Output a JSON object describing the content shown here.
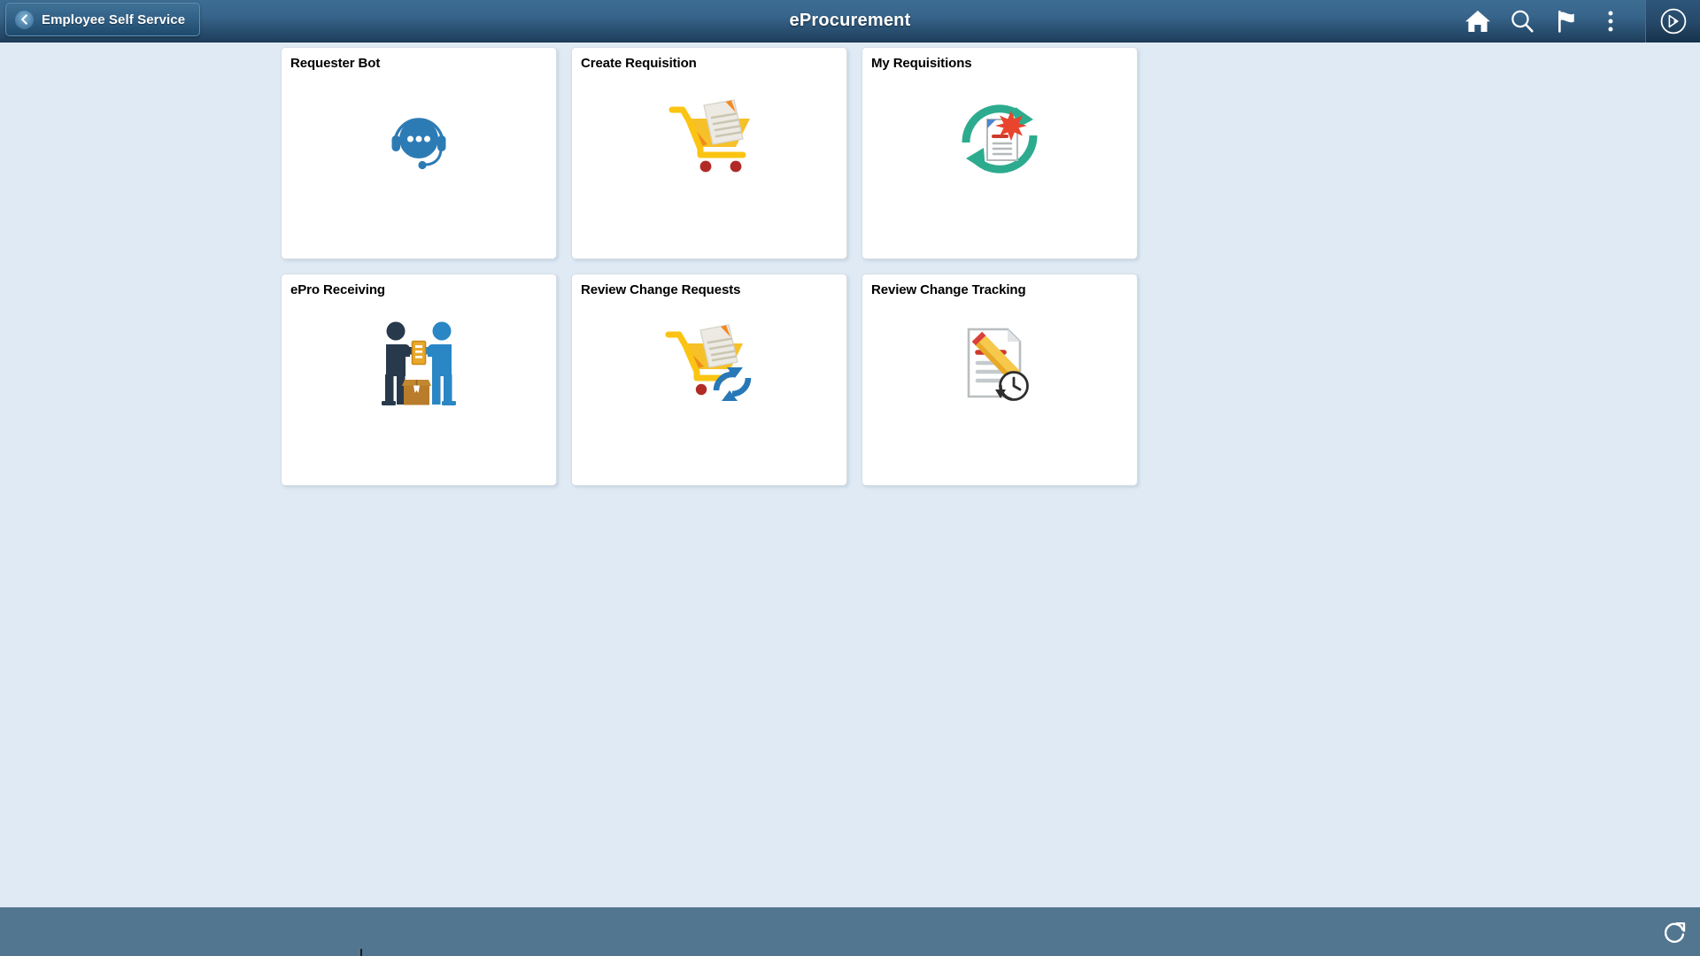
{
  "header": {
    "back_label": "Employee Self Service",
    "back_icon": "chevron-left-icon",
    "title": "eProcurement",
    "actions": [
      {
        "name": "home-icon",
        "label": "Home"
      },
      {
        "name": "search-icon",
        "label": "Search"
      },
      {
        "name": "flag-icon",
        "label": "Notifications"
      },
      {
        "name": "kebab-menu-icon",
        "label": "Actions"
      }
    ],
    "navbar_button": {
      "name": "navbar-compass-icon",
      "label": "NavBar"
    },
    "colors": {
      "bar_top": "#3d6d93",
      "bar_bottom": "#1e3f5c",
      "text": "#ffffff"
    }
  },
  "page": {
    "background": "#dfeaf5"
  },
  "tiles": [
    {
      "title": "Requester Bot",
      "icon": "chat-bot-headset-icon",
      "row": 1,
      "col": 1
    },
    {
      "title": "Create Requisition",
      "icon": "cart-with-document-icon",
      "row": 1,
      "col": 2
    },
    {
      "title": "My Requisitions",
      "icon": "document-refresh-cycle-icon",
      "row": 1,
      "col": 3
    },
    {
      "title": "ePro Receiving",
      "icon": "two-people-package-icon",
      "row": 1,
      "col": 4
    },
    {
      "title": "Review Change Requests",
      "icon": "cart-document-refresh-icon",
      "row": 2,
      "col": 1
    },
    {
      "title": "Review Change Tracking",
      "icon": "document-pencil-clock-icon",
      "row": 2,
      "col": 2
    }
  ],
  "footer": {
    "background": "#527590",
    "refresh": {
      "name": "refresh-icon",
      "label": "Refresh"
    }
  }
}
